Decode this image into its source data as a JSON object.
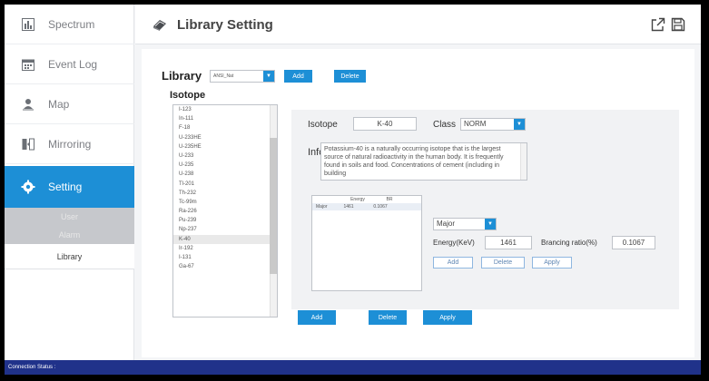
{
  "sidebar": {
    "items": [
      {
        "label": "Spectrum",
        "icon": "spectrum-icon"
      },
      {
        "label": "Event Log",
        "icon": "calendar-icon"
      },
      {
        "label": "Map",
        "icon": "map-person-icon"
      },
      {
        "label": "Mirroring",
        "icon": "mirroring-icon"
      },
      {
        "label": "Setting",
        "icon": "gear-icon",
        "active": true
      }
    ],
    "sub_items": [
      "User",
      "Alarm",
      "Library"
    ]
  },
  "header": {
    "title": "Library Setting",
    "title_icon": "book-icon",
    "icons": [
      "export-icon",
      "save-icon"
    ]
  },
  "library": {
    "label": "Library",
    "selected": "ANSI_Nat",
    "add_label": "Add",
    "delete_label": "Delete"
  },
  "isotope": {
    "label": "Isotope",
    "items": [
      "I-123",
      "In-111",
      "F-18",
      "U-233HE",
      "U-235HE",
      "U-233",
      "U-235",
      "U-238",
      "Tl-201",
      "Th-232",
      "Tc-99m",
      "Ra-226",
      "Pu-239",
      "Np-237",
      "K-40",
      "Ir-192",
      "I-131",
      "Ga-67"
    ],
    "selected": "K-40"
  },
  "detail": {
    "isotope_label": "Isotope",
    "isotope_value": "K-40",
    "class_label": "Class",
    "class_value": "NORM",
    "info_label": "Info",
    "info_text": "Potassium-40 is a naturally occurring isotope that is the largest source of natural radioactivity in the human body. It is frequently found in soils and food. Concentrations of cement (including in building",
    "table": {
      "headers": [
        "",
        "Energy",
        "BR"
      ],
      "rows": [
        [
          "Major",
          "1461",
          "0.1067"
        ]
      ]
    },
    "peak_type": "Major",
    "energy_label": "Energy(KeV)",
    "energy_value": "1461",
    "br_label": "Brancing ratio(%)",
    "br_value": "0.1067",
    "add_label": "Add",
    "delete_label": "Delete",
    "apply_label": "Apply"
  },
  "footer_buttons": {
    "add": "Add",
    "delete": "Delete",
    "apply": "Apply"
  },
  "status": {
    "text": "Connection Status :"
  },
  "colors": {
    "accent": "#1d8fd6",
    "statusbar": "#20328a"
  }
}
